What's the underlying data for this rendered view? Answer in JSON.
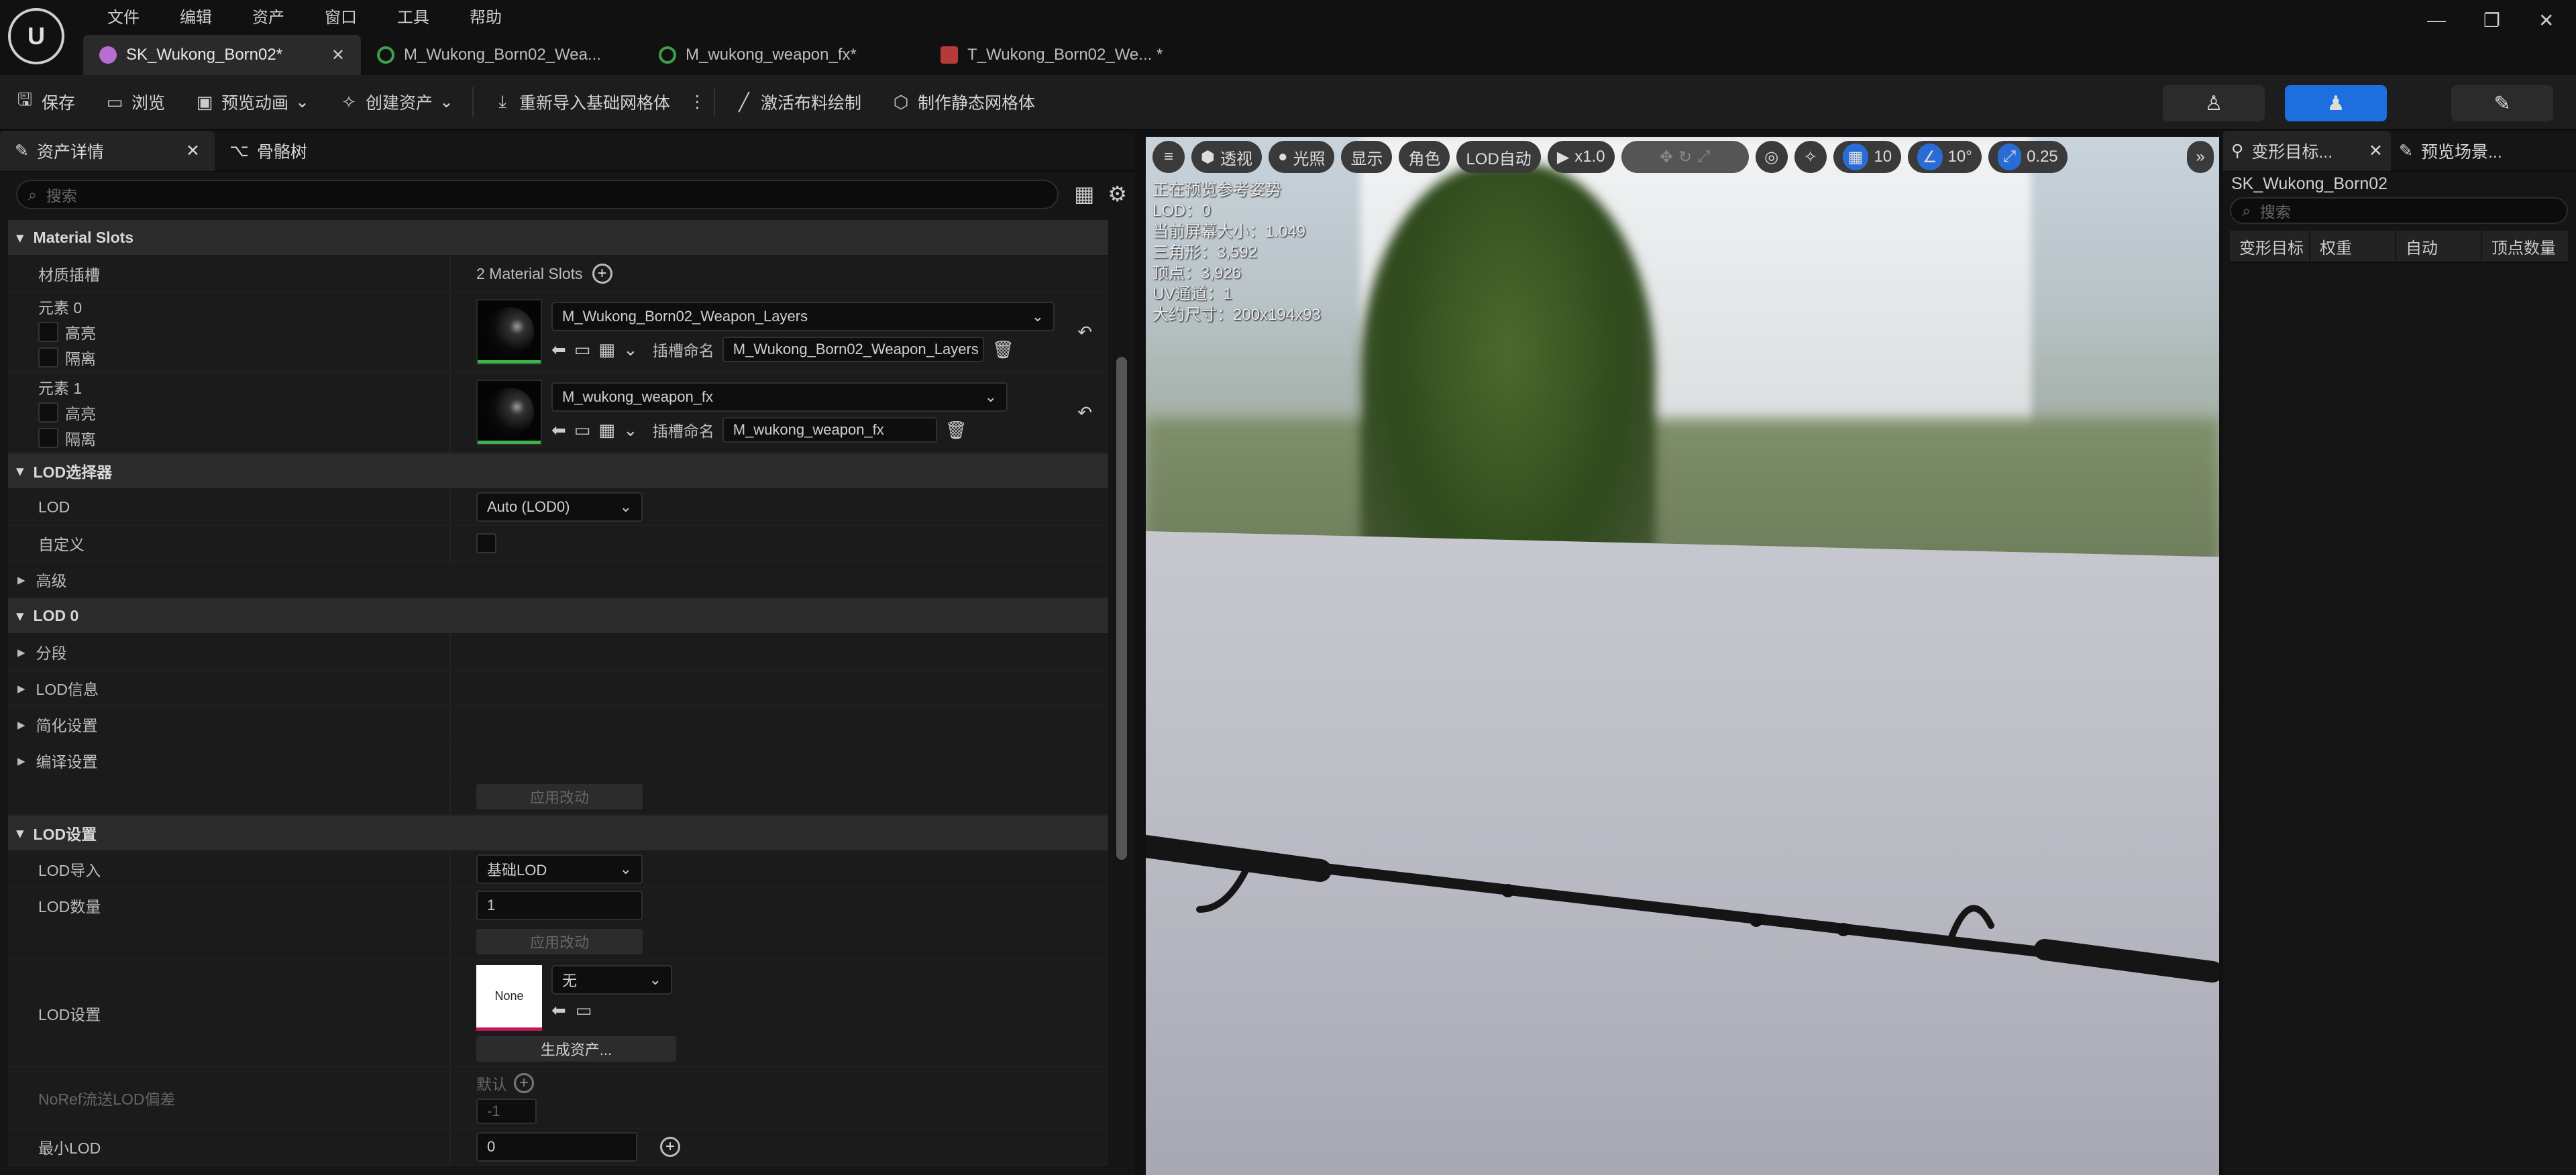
{
  "title_bar": {
    "menu": [
      "文件",
      "编辑",
      "资产",
      "窗口",
      "工具",
      "帮助"
    ],
    "tabs": [
      {
        "label": "SK_Wukong_Born02*",
        "color": "#b66fd1"
      },
      {
        "label": "M_Wukong_Born02_Wea...",
        "color": "#3da04a"
      },
      {
        "label": "M_wukong_weapon_fx*",
        "color": "#3da04a"
      },
      {
        "label": "T_Wukong_Born02_We... *",
        "color": "#b33b3b"
      }
    ]
  },
  "toolbar": {
    "save": "保存",
    "browse": "浏览",
    "preview_anim": "预览动画",
    "create_asset": "创建资产",
    "reimport": "重新导入基础网格体",
    "cloth_paint": "激活布料绘制",
    "make_static": "制作静态网格体"
  },
  "left_panel": {
    "tab_details": "资产详情",
    "tab_skeleton": "骨骼树",
    "search_placeholder": "搜索",
    "material_slots_header": "Material Slots",
    "material_slots_label": "材质插槽",
    "material_slots_value": "2 Material Slots",
    "element0": {
      "label": "元素 0",
      "highlight": "高亮",
      "isolate": "隔离",
      "material": "M_Wukong_Born02_Weapon_Layers",
      "slot_name_label": "插槽命名",
      "slot_name": "M_Wukong_Born02_Weapon_Layers"
    },
    "element1": {
      "label": "元素 1",
      "highlight": "高亮",
      "isolate": "隔离",
      "material": "M_wukong_weapon_fx",
      "slot_name_label": "插槽命名",
      "slot_name": "M_wukong_weapon_fx"
    },
    "lod_picker_header": "LOD选择器",
    "lod_label": "LOD",
    "lod_value": "Auto (LOD0)",
    "custom_label": "自定义",
    "advanced_label": "高级",
    "lod0_header": "LOD 0",
    "sections": "分段",
    "lod_info": "LOD信息",
    "reduction": "简化设置",
    "build": "编译设置",
    "apply_changes": "应用改动",
    "lod_settings_header": "LOD设置",
    "lod_import_label": "LOD导入",
    "lod_import_value": "基础LOD",
    "lod_count_label": "LOD数量",
    "lod_count_value": "1",
    "apply_changes2": "应用改动",
    "lod_settings_label": "LOD设置",
    "lod_settings_thumb": "None",
    "lod_settings_combo": "无",
    "generate_asset": "生成资产...",
    "noref_label": "NoRef流送LOD偏差",
    "default_label": "默认",
    "noref_value": "-1",
    "min_lod_label": "最小LOD",
    "min_lod_value": "0"
  },
  "viewport": {
    "perspective": "透视",
    "lit": "光照",
    "show": "显示",
    "character": "角色",
    "lod_auto": "LOD自动",
    "play_speed": "x1.0",
    "grid": "10",
    "angle": "10°",
    "scale": "0.25",
    "stats": [
      "正在预览参考姿势",
      "LOD：0",
      "当前屏幕大小：1.049",
      "三角形：3,592",
      "顶点：3,926",
      "UV通道：1",
      "大约尺寸：200x194x93"
    ]
  },
  "right_panel": {
    "tab_morph": "变形目标...",
    "tab_preview": "预览场景...",
    "asset_name": "SK_Wukong_Born02",
    "search_placeholder": "搜索",
    "columns": [
      "变形目标",
      "权重",
      "自动",
      "顶点数量"
    ]
  }
}
